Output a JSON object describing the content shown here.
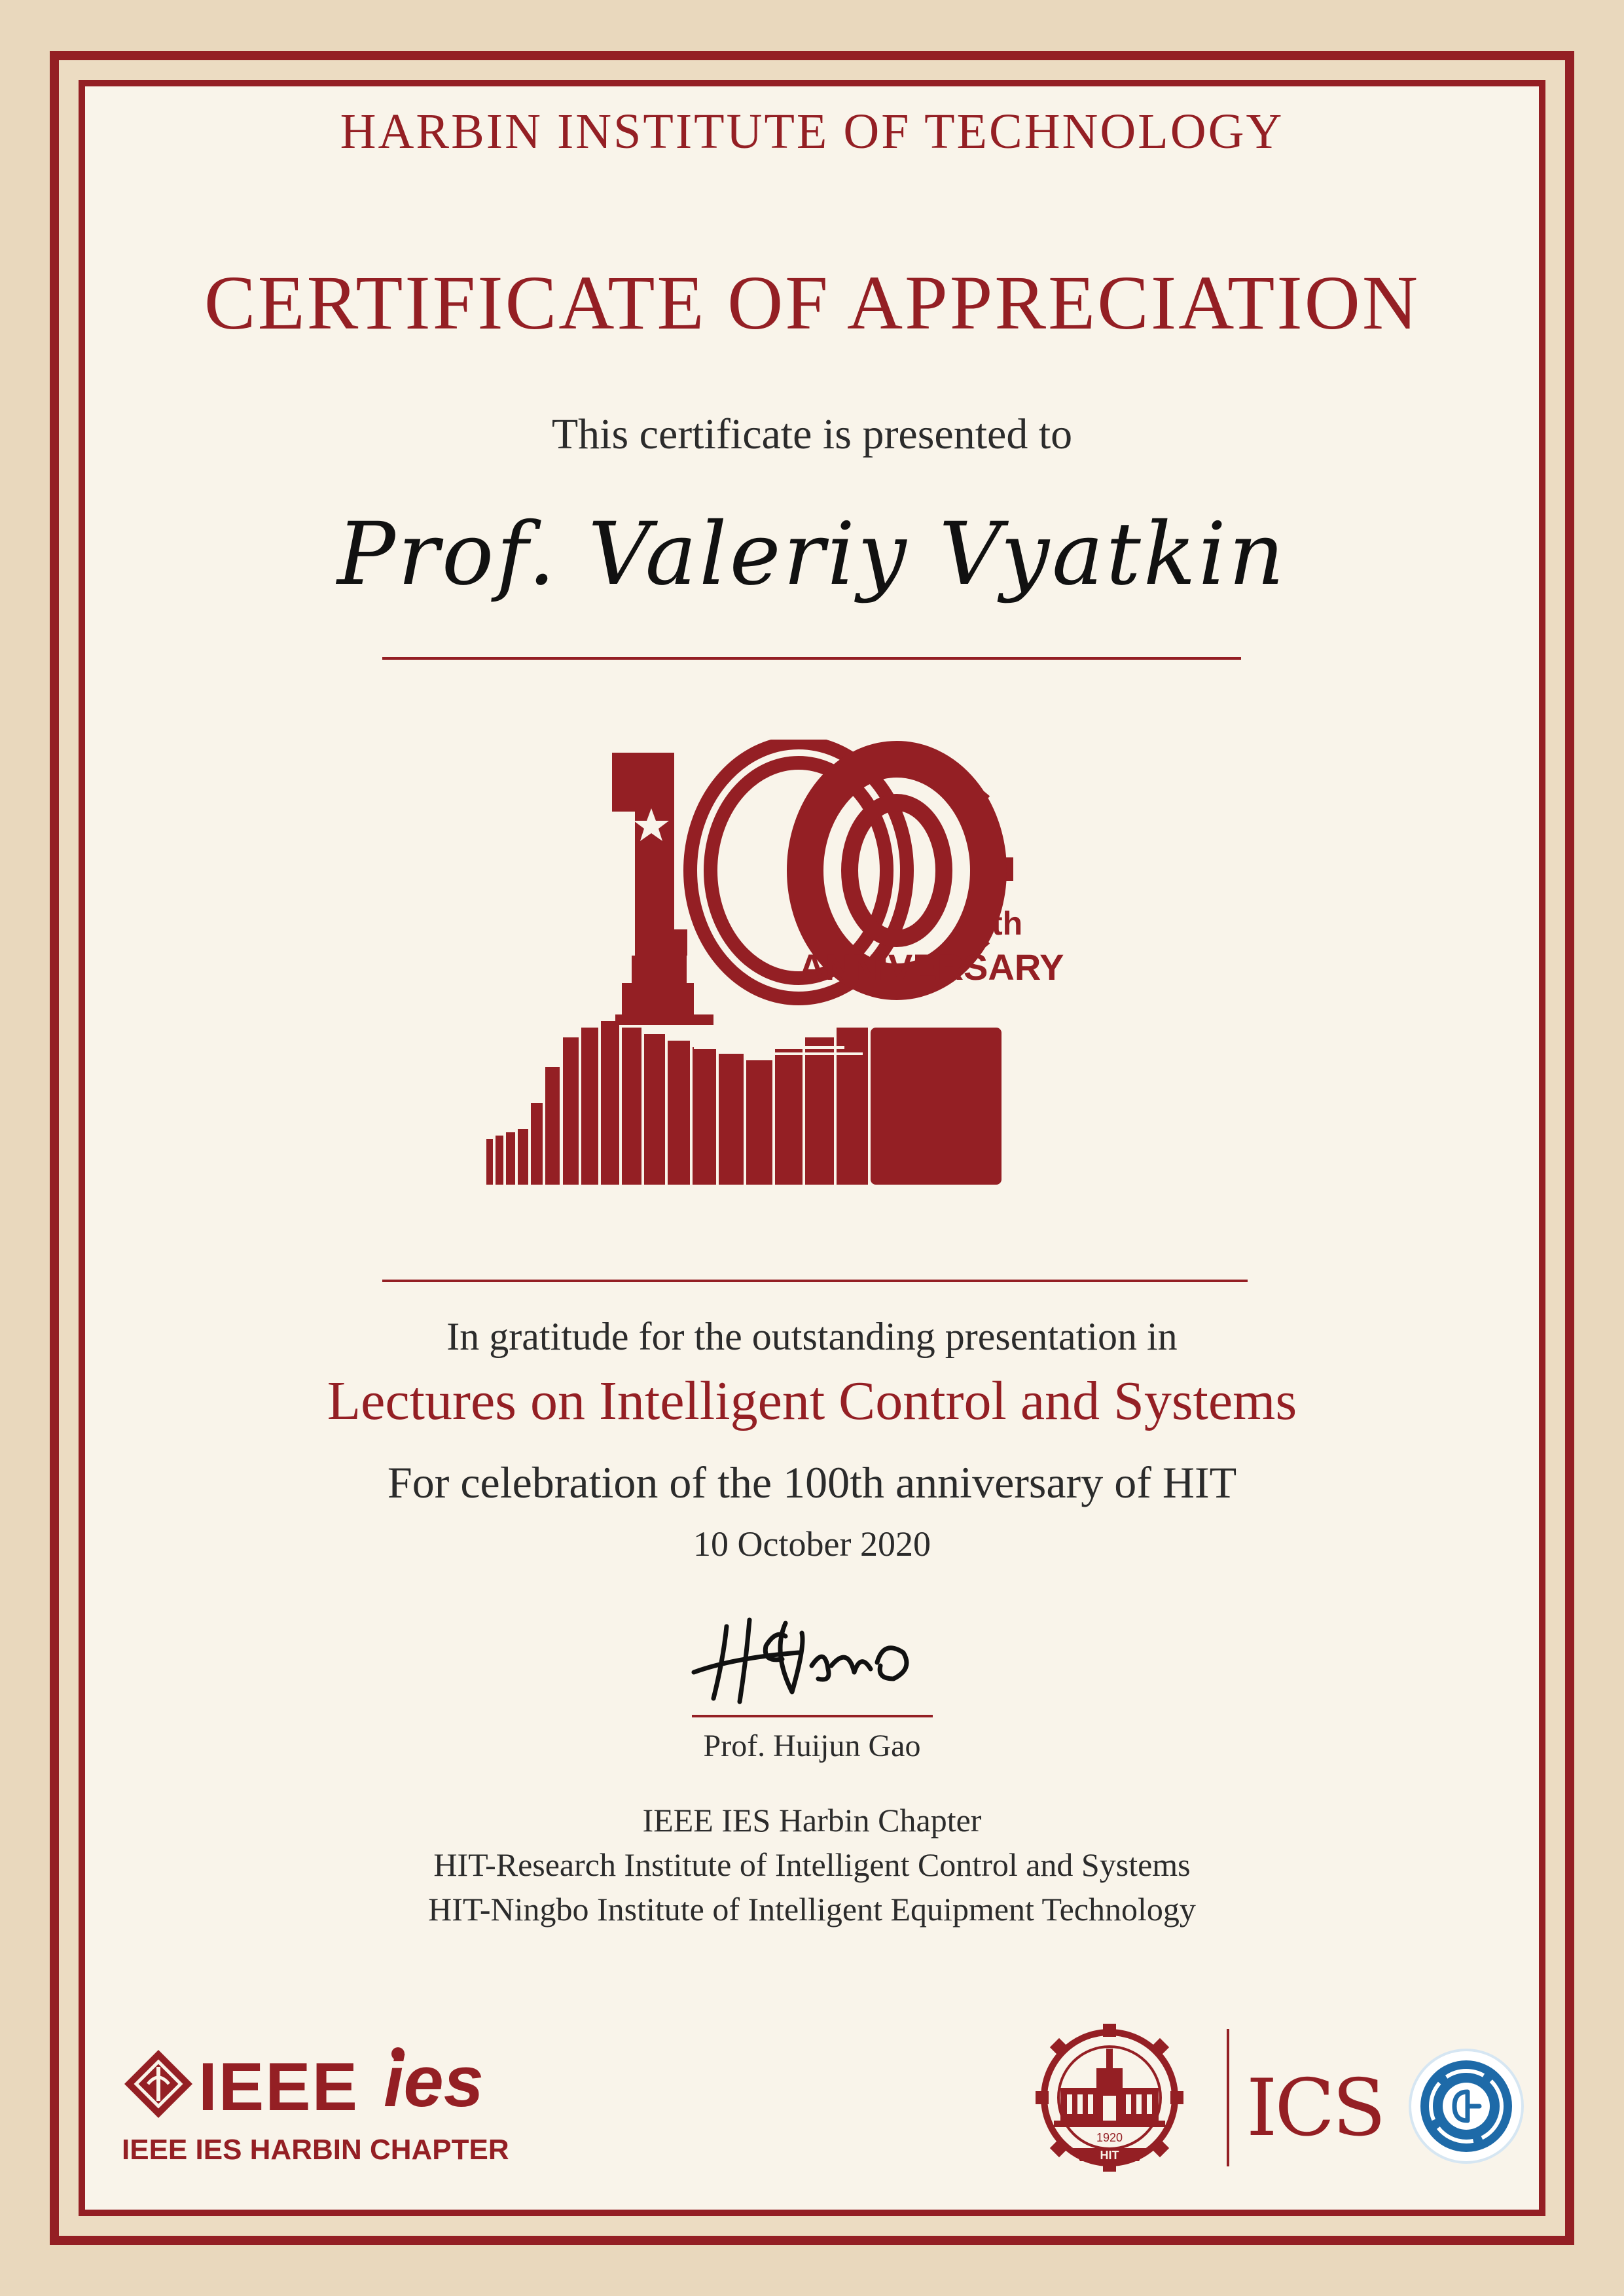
{
  "institution": "HARBIN INSTITUTE OF TECHNOLOGY",
  "title": "CERTIFICATE OF APPRECIATION",
  "presented_to_label": "This certificate is presented to",
  "recipient": "Prof. Valeriy Vyatkin",
  "logo_100": {
    "suffix": "th",
    "word": "ANNIVERSARY"
  },
  "gratitude_line": "In gratitude for the outstanding presentation in",
  "lecture_series": "Lectures on Intelligent Control and Systems",
  "celebration_line": "For celebration of the 100th anniversary of HIT",
  "date": "10 October 2020",
  "signature_text": "H Gao",
  "signer": "Prof. Huijun Gao",
  "organizations": [
    "IEEE IES Harbin Chapter",
    "HIT-Research Institute of Intelligent Control and Systems",
    "HIT-Ningbo Institute of  Intelligent Equipment Technology"
  ],
  "footer": {
    "ieee_word": "IEEE",
    "ies_word": "ies",
    "chapter_label": "IEEE IES HARBIN CHAPTER",
    "hit_seal_year": "1920",
    "hit_seal_label": "HIT",
    "ics_label": "ICS"
  },
  "colors": {
    "accent": "#941f24",
    "paper": "#f9f4ea",
    "frame_light": "#e9d8bd",
    "text": "#2b2b2b"
  }
}
